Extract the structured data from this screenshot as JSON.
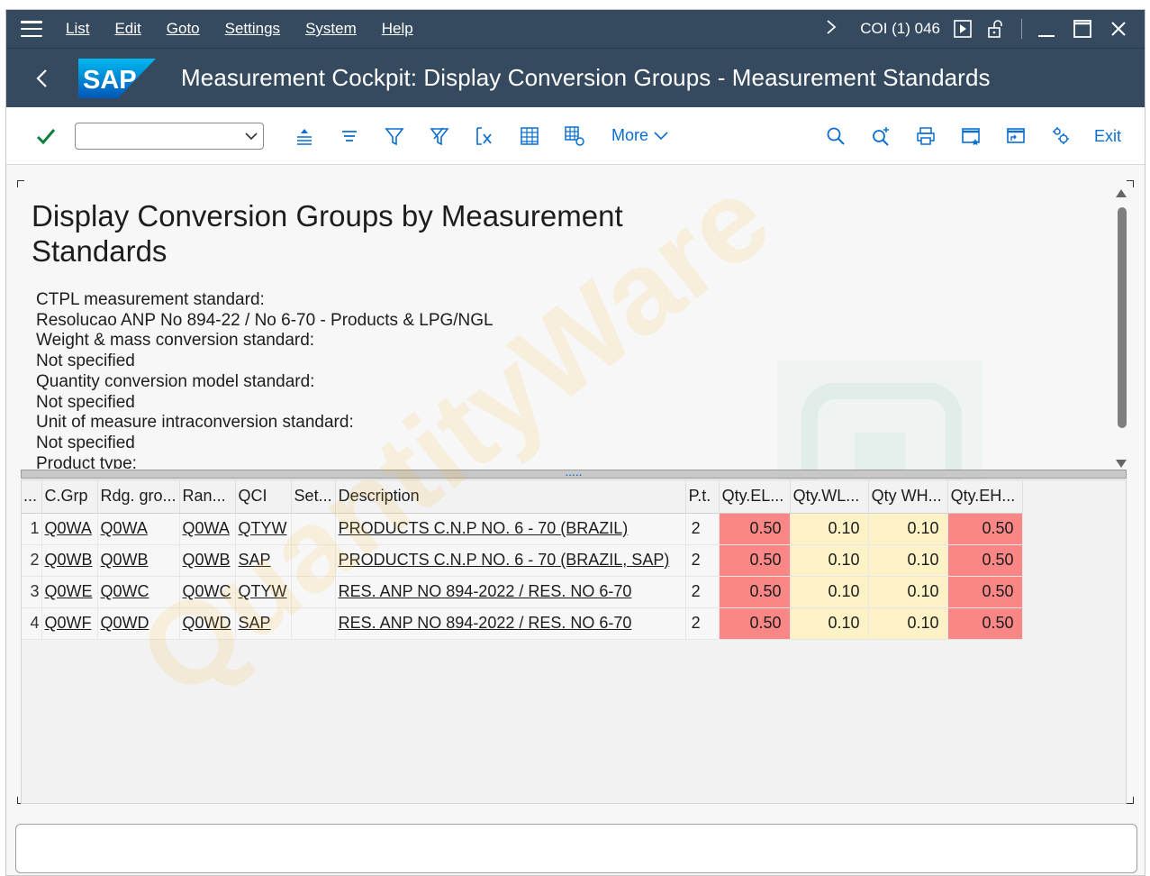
{
  "menubar": {
    "items": [
      "List",
      "Edit",
      "Goto",
      "Settings",
      "System",
      "Help"
    ],
    "system_info": "COI (1) 046"
  },
  "titlebar": {
    "logo_text": "SAP",
    "title": "Measurement Cockpit: Display Conversion Groups - Measurement Standards"
  },
  "toolbar": {
    "command_value": "",
    "more_label": "More",
    "exit_label": "Exit"
  },
  "report": {
    "title": "Display Conversion Groups by Measurement Standards",
    "info_lines": [
      "CTPL measurement standard:",
      "Resolucao ANP No 894-22 / No 6-70 - Products & LPG/NGL",
      "Weight & mass conversion standard:",
      "Not specified",
      "Quantity conversion model standard:",
      "Not specified",
      "Unit of measure intraconversion standard:",
      "Not specified",
      "Product type:"
    ]
  },
  "grid": {
    "headers": [
      "...",
      "C.Grp",
      "Rdg. gro...",
      "Ran...",
      "QCI",
      "Set...",
      "Description",
      "P.t.",
      "Qty.EL...",
      "Qty.WL...",
      "Qty WH...",
      "Qty.EH..."
    ],
    "rows": [
      {
        "n": "1",
        "cgrp": "Q0WA",
        "rdg": "Q0WA",
        "ran": "Q0WA",
        "qci": "QTYW",
        "set": "",
        "desc": "PRODUCTS C.N.P NO. 6 - 70 (BRAZIL)",
        "pt": "2",
        "el": "0.50",
        "wl": "0.10",
        "wh": "0.10",
        "eh": "0.50"
      },
      {
        "n": "2",
        "cgrp": "Q0WB",
        "rdg": "Q0WB",
        "ran": "Q0WB",
        "qci": "SAP",
        "set": "",
        "desc": "PRODUCTS C.N.P NO. 6 - 70 (BRAZIL, SAP)",
        "pt": "2",
        "el": "0.50",
        "wl": "0.10",
        "wh": "0.10",
        "eh": "0.50"
      },
      {
        "n": "3",
        "cgrp": "Q0WE",
        "rdg": "Q0WC",
        "ran": "Q0WC",
        "qci": "QTYW",
        "set": "",
        "desc": "RES. ANP NO 894-2022 / RES. NO 6-70",
        "pt": "2",
        "el": "0.50",
        "wl": "0.10",
        "wh": "0.10",
        "eh": "0.50"
      },
      {
        "n": "4",
        "cgrp": "Q0WF",
        "rdg": "Q0WD",
        "ran": "Q0WD",
        "qci": "SAP",
        "set": "",
        "desc": "RES. ANP NO 894-2022 / RES. NO 6-70",
        "pt": "2",
        "el": "0.50",
        "wl": "0.10",
        "wh": "0.10",
        "eh": "0.50"
      }
    ]
  },
  "watermark": {
    "text": "QuantityWare"
  },
  "colors": {
    "shell": "#354a5f",
    "accent": "#0a6ed1",
    "red_cell": "#fa8686",
    "yellow_cell": "#fdf1c6",
    "check": "#107e3e"
  }
}
